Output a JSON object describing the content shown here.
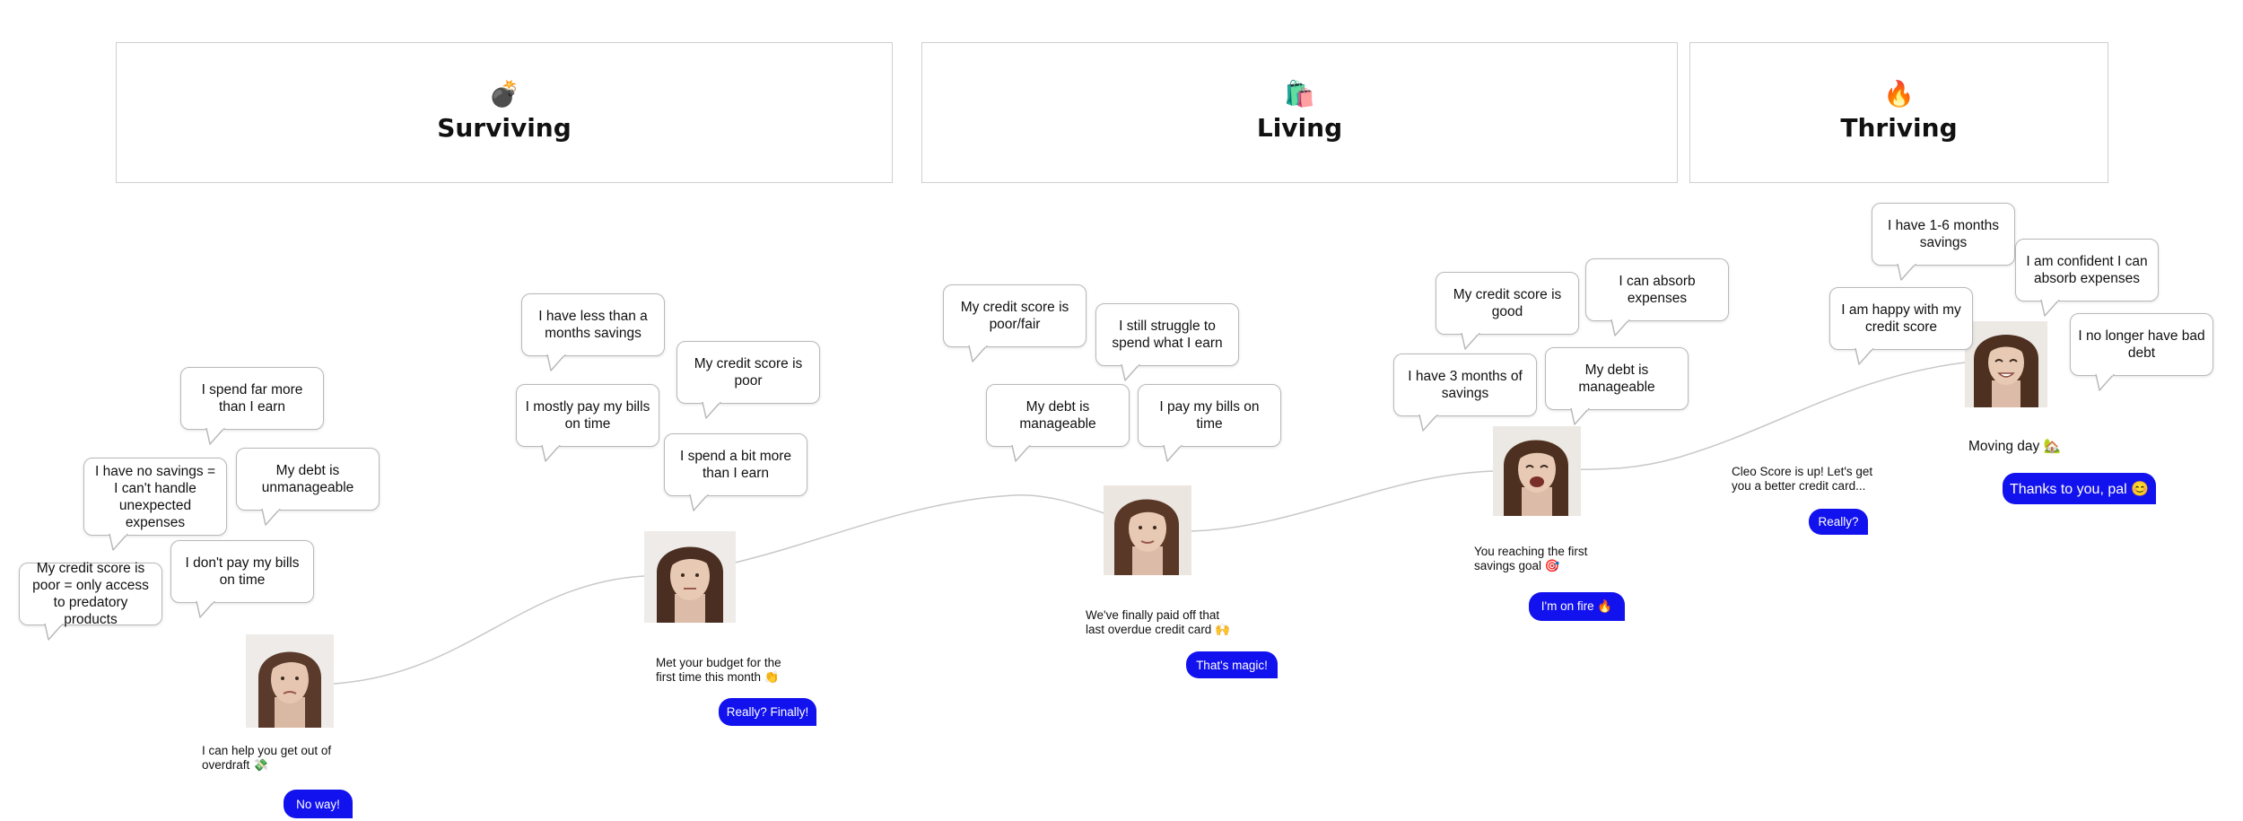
{
  "stages": [
    {
      "emoji": "💣",
      "title": "Surviving"
    },
    {
      "emoji": "🛍️",
      "title": "Living"
    },
    {
      "emoji": "🔥",
      "title": "Thriving"
    }
  ],
  "groups": [
    {
      "bubbles": [
        "My credit score is poor = only access to predatory products",
        "I have no savings = I can't handle unexpected expenses",
        "I spend far more than I earn",
        "My debt is unmanageable",
        "I don't pay my bills on time"
      ],
      "message": "I can help you get out of overdraft 💸",
      "reply": "No way!"
    },
    {
      "bubbles": [
        "I have less than a months savings",
        "I mostly pay my bills on time",
        "My credit score is poor",
        "I spend a bit more than I earn"
      ],
      "message": "Met your budget for the first time this month 👏",
      "reply": "Really? Finally!"
    },
    {
      "bubbles": [
        "My credit score is poor/fair",
        "I still struggle to spend what I earn",
        "My debt is manageable",
        "I pay my bills on time"
      ],
      "message": "We've finally paid off that last overdue credit card 🙌",
      "reply": "That's magic!"
    },
    {
      "bubbles": [
        "My credit score is good",
        "I can absorb expenses",
        "I have 3 months of savings",
        "My debt is manageable"
      ],
      "message": "You reaching the first savings goal 🎯",
      "reply": "I'm on fire 🔥"
    },
    {
      "bubbles": [
        "I have 1-6 months savings",
        "I am confident I can absorb expenses",
        "I am happy with my credit score",
        "I no longer have bad debt"
      ],
      "message": "Cleo Score is up! Let's get you a better credit card...",
      "reply": "Really?",
      "message2": "Moving day 🏡",
      "reply2": "Thanks to you, pal 😊"
    }
  ],
  "colors": {
    "accent": "#1212ee",
    "border": "#b9b9b9",
    "curve": "#c8c8c8"
  }
}
